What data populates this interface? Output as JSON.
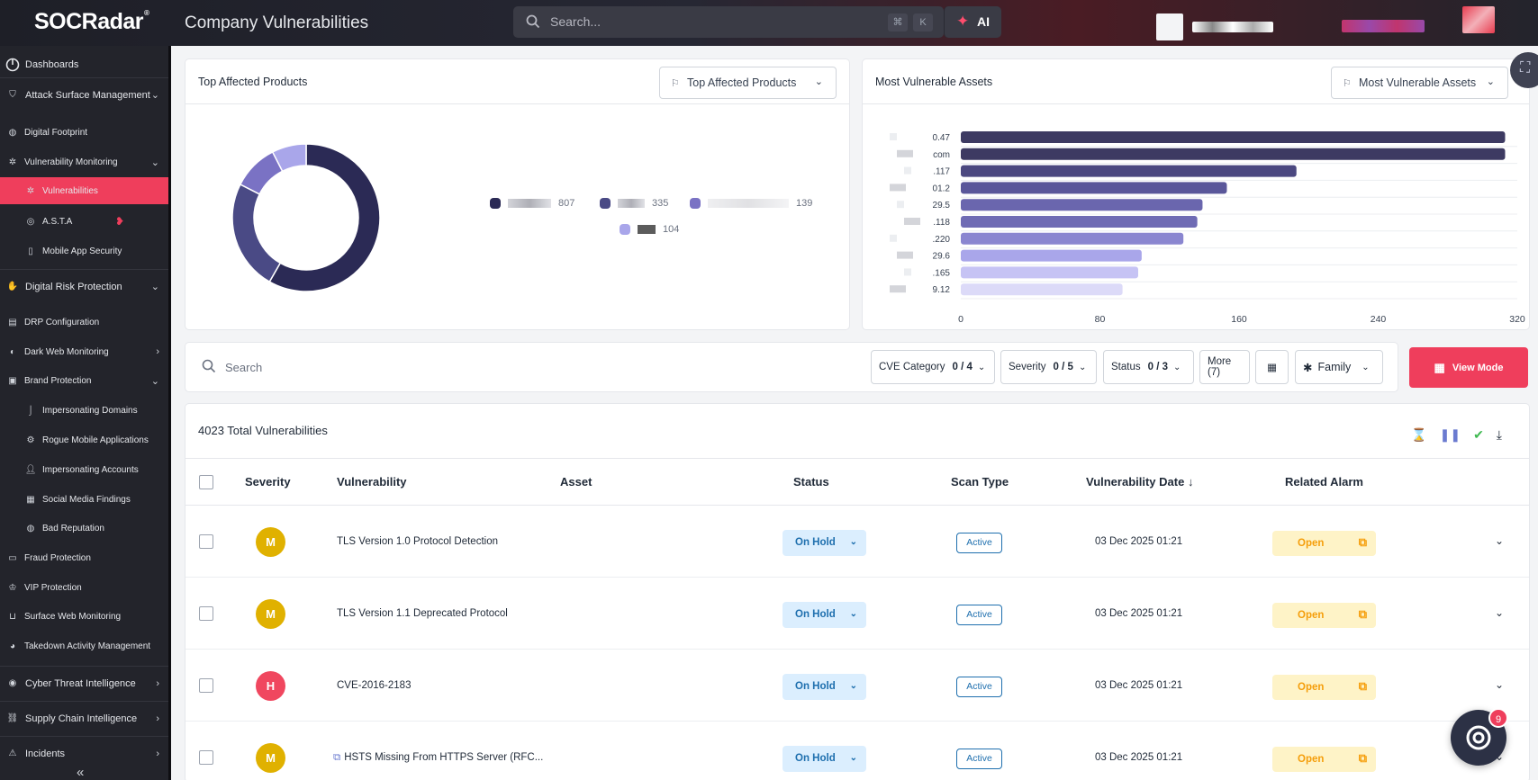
{
  "header": {
    "logo": "SOCRadar",
    "logo_mark": "®",
    "page_title": "Company Vulnerabilities",
    "search_placeholder": "Search...",
    "kbd_cmd": "⌘",
    "kbd_k": "K",
    "ai_label": "AI"
  },
  "sidebar": {
    "items": [
      {
        "label": "Dashboards",
        "icon": "dashboard-icon"
      },
      {
        "label": "Attack Surface Management",
        "icon": "shield-icon"
      },
      {
        "label": "Digital Footprint",
        "icon": "globe-icon"
      },
      {
        "label": "Vulnerability Monitoring",
        "icon": "bug-icon"
      },
      {
        "label": "Vulnerabilities",
        "icon": "bug-icon"
      },
      {
        "label": "A.S.T.A",
        "icon": "target-icon"
      },
      {
        "label": "Mobile App Security",
        "icon": "mobile-icon"
      },
      {
        "label": "Digital Risk Protection",
        "icon": "hand-shield-icon"
      },
      {
        "label": "DRP Configuration",
        "icon": "config-icon"
      },
      {
        "label": "Dark Web Monitoring",
        "icon": "spy-icon"
      },
      {
        "label": "Brand Protection",
        "icon": "briefcase-icon"
      },
      {
        "label": "Impersonating Domains",
        "icon": "hook-icon"
      },
      {
        "label": "Rogue Mobile Applications",
        "icon": "gear-icon"
      },
      {
        "label": "Impersonating Accounts",
        "icon": "user-icon"
      },
      {
        "label": "Social Media Findings",
        "icon": "grid-icon"
      },
      {
        "label": "Bad Reputation",
        "icon": "globe-icon"
      },
      {
        "label": "Fraud Protection",
        "icon": "card-icon"
      },
      {
        "label": "VIP Protection",
        "icon": "vip-icon"
      },
      {
        "label": "Surface Web Monitoring",
        "icon": "cart-icon"
      },
      {
        "label": "Takedown Activity Management",
        "icon": "takedown-icon"
      },
      {
        "label": "Cyber Threat Intelligence",
        "icon": "eye-icon"
      },
      {
        "label": "Supply Chain Intelligence",
        "icon": "network-icon"
      },
      {
        "label": "Incidents",
        "icon": "alert-icon"
      }
    ]
  },
  "top_products": {
    "title": "Top Affected Products",
    "dropdown": "Top Affected Products",
    "legend": [
      {
        "value": "807",
        "color": "#2b2a55"
      },
      {
        "value": "335",
        "color": "#4a4a85"
      },
      {
        "value": "139",
        "color": "#7a72c4"
      },
      {
        "value": "104",
        "color": "#a9a6ea"
      }
    ]
  },
  "vulnerable_assets": {
    "title": "Most Vulnerable Assets",
    "dropdown": "Most Vulnerable Assets",
    "x_ticks": [
      "0",
      "80",
      "160",
      "240",
      "320"
    ]
  },
  "chart_data": [
    {
      "type": "pie",
      "title": "Top Affected Products",
      "values": [
        807,
        335,
        139,
        104
      ]
    },
    {
      "type": "bar",
      "title": "Most Vulnerable Assets",
      "orientation": "horizontal",
      "categories": [
        "0.47",
        "com",
        ".117",
        "01.2",
        "29.5",
        ".118",
        ".220",
        "29.6",
        ".165",
        "9.12"
      ],
      "values": [
        313,
        313,
        193,
        153,
        139,
        136,
        128,
        104,
        102,
        93
      ],
      "xlim": [
        0,
        320
      ],
      "grid": true
    }
  ],
  "filters": {
    "search_placeholder": "Search",
    "cve_category": "CVE Category",
    "cve_value": "0 / 4",
    "severity": "Severity",
    "severity_value": "0 / 5",
    "status": "Status",
    "status_value": "0 / 3",
    "more": "More (7)",
    "family": "Family",
    "view_mode": "View Mode"
  },
  "table": {
    "total": "4023 Total Vulnerabilities",
    "columns": [
      "Severity",
      "Vulnerability",
      "Asset",
      "Status",
      "Scan Type",
      "Vulnerability Date",
      "Related Alarm"
    ],
    "rows": [
      {
        "severity": "M",
        "sev_color": "#e0b100",
        "name": "TLS Version 1.0 Protocol Detection",
        "status": "On Hold",
        "scan": "Active",
        "date": "03 Dec 2025 01:21",
        "alarm": "Open"
      },
      {
        "severity": "M",
        "sev_color": "#e0b100",
        "name": "TLS Version 1.1 Deprecated Protocol",
        "status": "On Hold",
        "scan": "Active",
        "date": "03 Dec 2025 01:21",
        "alarm": "Open"
      },
      {
        "severity": "H",
        "sev_color": "#f0475f",
        "name": "CVE-2016-2183",
        "status": "On Hold",
        "scan": "Active",
        "date": "03 Dec 2025 01:21",
        "alarm": "Open"
      },
      {
        "severity": "M",
        "sev_color": "#e0b100",
        "name": "HSTS Missing From HTTPS Server (RFC...",
        "status": "On Hold",
        "scan": "Active",
        "date": "03 Dec 2025 01:21",
        "alarm": "Open"
      }
    ]
  },
  "chat_badge": "9"
}
